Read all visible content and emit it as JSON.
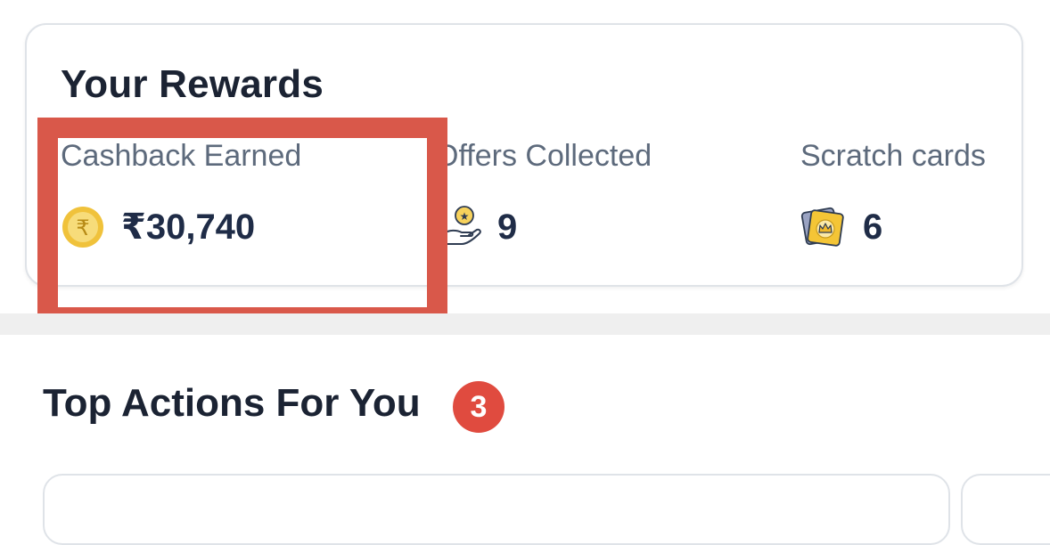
{
  "rewards": {
    "title": "Your Rewards",
    "stats": [
      {
        "label": "Cashback Earned",
        "value": "₹30,740",
        "icon": "rupee-coin-icon"
      },
      {
        "label": "Offers Collected",
        "value": "9",
        "icon": "offer-hand-icon"
      },
      {
        "label": "Scratch cards",
        "value": "6",
        "icon": "scratch-card-icon"
      }
    ]
  },
  "highlight": {
    "color": "#d9584a",
    "target": "Cashback Earned"
  },
  "top_actions": {
    "title": "Top Actions For You",
    "badge_count": "3",
    "badge_color": "#e04b3f"
  },
  "colors": {
    "title_text": "#1b2333",
    "label_text": "#5d6a7c",
    "value_text": "#1f2c47",
    "coin": "#f3cd4a"
  }
}
